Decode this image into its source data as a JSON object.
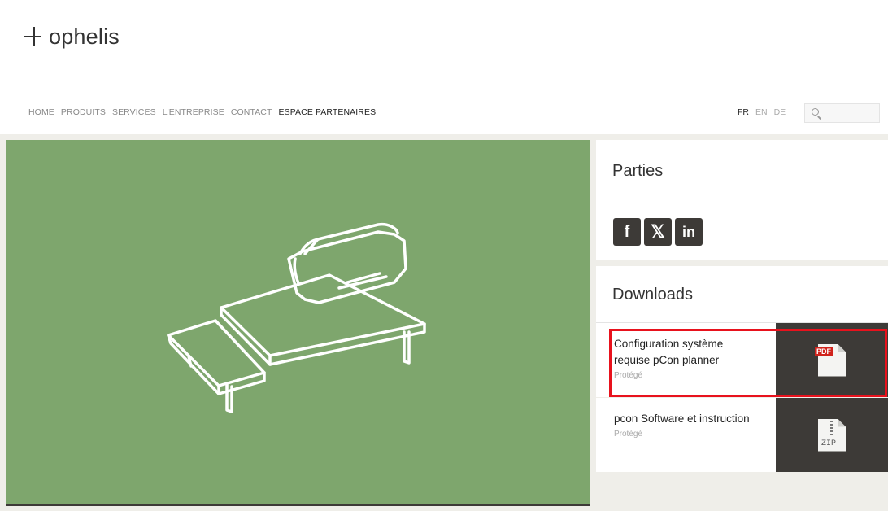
{
  "brand": {
    "name": "ophelis"
  },
  "nav": {
    "items": [
      {
        "label": "HOME"
      },
      {
        "label": "PRODUITS"
      },
      {
        "label": "SERVICES"
      },
      {
        "label": "L'ENTREPRISE"
      },
      {
        "label": "CONTACT"
      },
      {
        "label": "ESPACE PARTENAIRES",
        "active": true
      }
    ]
  },
  "languages": [
    {
      "code": "FR",
      "active": true
    },
    {
      "code": "EN"
    },
    {
      "code": "DE"
    }
  ],
  "search": {
    "placeholder": "",
    "value": "",
    "icon": "search-icon"
  },
  "hero": {
    "background": "#7ea66d",
    "icon": "sofa-illustration"
  },
  "share_panel": {
    "title": "Parties",
    "networks": [
      {
        "name": "facebook",
        "glyph": "f",
        "icon": "facebook-icon"
      },
      {
        "name": "xing",
        "glyph": "𝕏",
        "icon": "xing-icon"
      },
      {
        "name": "linkedin",
        "glyph": "in",
        "icon": "linkedin-icon"
      }
    ]
  },
  "downloads_panel": {
    "title": "Downloads",
    "items": [
      {
        "title": "Configuration système requise pCon planner",
        "subtitle": "Protégé",
        "type": "PDF",
        "icon": "pdf-file-icon"
      },
      {
        "title": "pcon Software et instruction",
        "subtitle": "Protégé",
        "type": "ZIP",
        "icon": "zip-file-icon"
      }
    ]
  },
  "colors": {
    "dark": "#3d3a37",
    "hero_green": "#7ea66d",
    "highlight_red": "#e8121d",
    "page_bg": "#efeee9"
  }
}
